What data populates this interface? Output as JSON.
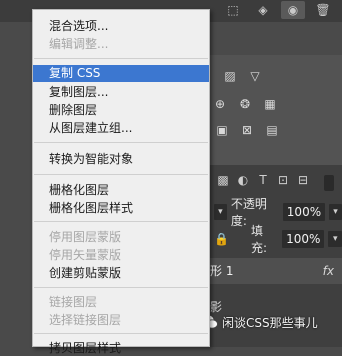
{
  "top_toolbar": {
    "icons": [
      "dotted-circle-icon",
      "layers-stack-icon",
      "eye-icon",
      "trash-icon"
    ]
  },
  "context_menu": {
    "items": [
      {
        "label": "混合选项...",
        "enabled": true
      },
      {
        "label": "编辑调整...",
        "enabled": false
      },
      {
        "label": "复制 CSS",
        "enabled": true,
        "highlighted": true
      },
      {
        "label": "复制图层...",
        "enabled": true
      },
      {
        "label": "删除图层",
        "enabled": true
      },
      {
        "label": "从图层建立组...",
        "enabled": true
      },
      {
        "label": "转换为智能对象",
        "enabled": true
      },
      {
        "label": "栅格化图层",
        "enabled": true
      },
      {
        "label": "栅格化图层样式",
        "enabled": true
      },
      {
        "label": "停用图层蒙版",
        "enabled": false
      },
      {
        "label": "停用矢量蒙版",
        "enabled": false
      },
      {
        "label": "创建剪贴蒙版",
        "enabled": true
      },
      {
        "label": "链接图层",
        "enabled": false
      },
      {
        "label": "选择链接图层",
        "enabled": false
      },
      {
        "label": "拷贝图层样式",
        "enabled": true
      }
    ]
  },
  "layers_panel": {
    "opacity_label": "不透明度:",
    "opacity_value": "100%",
    "fill_label": "填充:",
    "fill_value": "100%",
    "layer_name": "形 1",
    "fx_label": "fx",
    "partial_row_text": "影"
  },
  "watermark": {
    "text": "闲谈CSS那些事儿"
  }
}
